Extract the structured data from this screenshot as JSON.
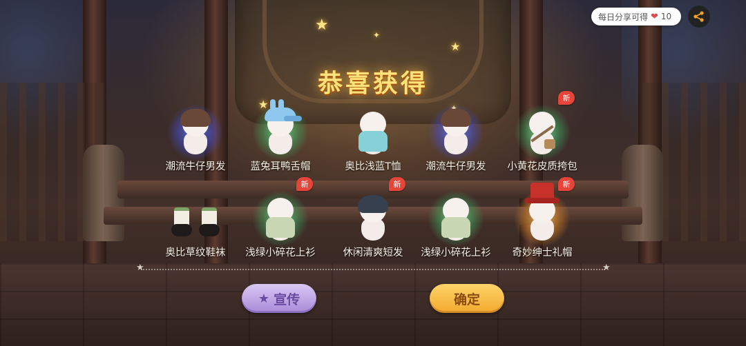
{
  "header": {
    "share_reward_text": "每日分享可得",
    "share_reward_count": "10",
    "share_icon": "share-icon",
    "reward_icon": "heart-icon"
  },
  "title": "恭喜获得",
  "new_badge": "新",
  "items": [
    {
      "name": "潮流牛仔男发",
      "glow": "blue",
      "kind": "hair",
      "is_new": false
    },
    {
      "name": "蓝兔耳鸭舌帽",
      "glow": "green",
      "kind": "cap",
      "is_new": false
    },
    {
      "name": "奥比浅蓝T恤",
      "glow": "none",
      "kind": "tshirt",
      "is_new": false
    },
    {
      "name": "潮流牛仔男发",
      "glow": "blue",
      "kind": "hair",
      "is_new": false
    },
    {
      "name": "小黄花皮质挎包",
      "glow": "green",
      "kind": "bag",
      "is_new": true
    },
    {
      "name": "奥比草纹鞋袜",
      "glow": "none",
      "kind": "shoes",
      "is_new": false
    },
    {
      "name": "浅绿小碎花上衫",
      "glow": "green",
      "kind": "shirt",
      "is_new": true
    },
    {
      "name": "休闲清爽短发",
      "glow": "none",
      "kind": "hair-dark",
      "is_new": true
    },
    {
      "name": "浅绿小碎花上衫",
      "glow": "green",
      "kind": "shirt",
      "is_new": false
    },
    {
      "name": "奇妙绅士礼帽",
      "glow": "gold",
      "kind": "tophat",
      "is_new": true
    }
  ],
  "buttons": {
    "promote": "宣传",
    "confirm": "确定"
  },
  "colors": {
    "title": "#ffe27a",
    "confirm_button": "#f2a92e",
    "promote_button": "#b89ae0",
    "new_badge": "#e8453a"
  }
}
